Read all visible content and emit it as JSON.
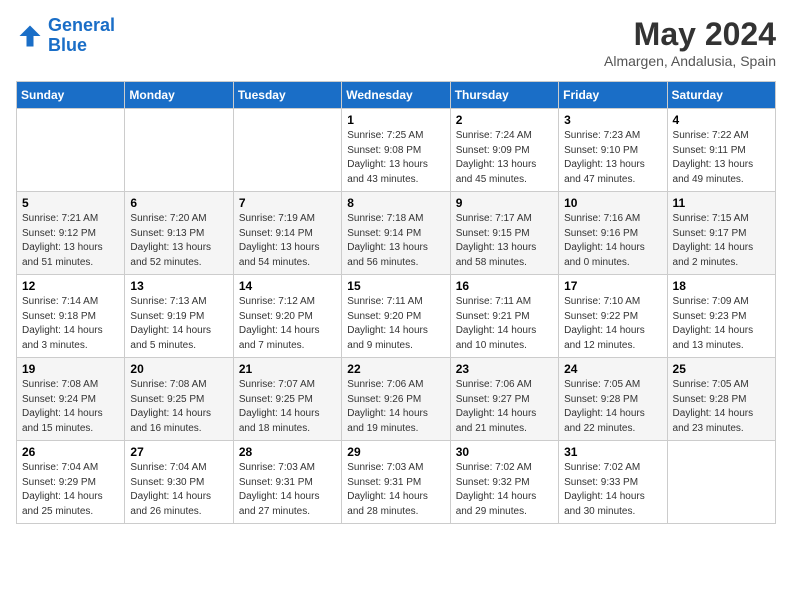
{
  "logo": {
    "line1": "General",
    "line2": "Blue"
  },
  "title": "May 2024",
  "location": "Almargen, Andalusia, Spain",
  "headers": [
    "Sunday",
    "Monday",
    "Tuesday",
    "Wednesday",
    "Thursday",
    "Friday",
    "Saturday"
  ],
  "weeks": [
    [
      {
        "day": "",
        "sunrise": "",
        "sunset": "",
        "daylight": ""
      },
      {
        "day": "",
        "sunrise": "",
        "sunset": "",
        "daylight": ""
      },
      {
        "day": "",
        "sunrise": "",
        "sunset": "",
        "daylight": ""
      },
      {
        "day": "1",
        "sunrise": "Sunrise: 7:25 AM",
        "sunset": "Sunset: 9:08 PM",
        "daylight": "Daylight: 13 hours and 43 minutes."
      },
      {
        "day": "2",
        "sunrise": "Sunrise: 7:24 AM",
        "sunset": "Sunset: 9:09 PM",
        "daylight": "Daylight: 13 hours and 45 minutes."
      },
      {
        "day": "3",
        "sunrise": "Sunrise: 7:23 AM",
        "sunset": "Sunset: 9:10 PM",
        "daylight": "Daylight: 13 hours and 47 minutes."
      },
      {
        "day": "4",
        "sunrise": "Sunrise: 7:22 AM",
        "sunset": "Sunset: 9:11 PM",
        "daylight": "Daylight: 13 hours and 49 minutes."
      }
    ],
    [
      {
        "day": "5",
        "sunrise": "Sunrise: 7:21 AM",
        "sunset": "Sunset: 9:12 PM",
        "daylight": "Daylight: 13 hours and 51 minutes."
      },
      {
        "day": "6",
        "sunrise": "Sunrise: 7:20 AM",
        "sunset": "Sunset: 9:13 PM",
        "daylight": "Daylight: 13 hours and 52 minutes."
      },
      {
        "day": "7",
        "sunrise": "Sunrise: 7:19 AM",
        "sunset": "Sunset: 9:14 PM",
        "daylight": "Daylight: 13 hours and 54 minutes."
      },
      {
        "day": "8",
        "sunrise": "Sunrise: 7:18 AM",
        "sunset": "Sunset: 9:14 PM",
        "daylight": "Daylight: 13 hours and 56 minutes."
      },
      {
        "day": "9",
        "sunrise": "Sunrise: 7:17 AM",
        "sunset": "Sunset: 9:15 PM",
        "daylight": "Daylight: 13 hours and 58 minutes."
      },
      {
        "day": "10",
        "sunrise": "Sunrise: 7:16 AM",
        "sunset": "Sunset: 9:16 PM",
        "daylight": "Daylight: 14 hours and 0 minutes."
      },
      {
        "day": "11",
        "sunrise": "Sunrise: 7:15 AM",
        "sunset": "Sunset: 9:17 PM",
        "daylight": "Daylight: 14 hours and 2 minutes."
      }
    ],
    [
      {
        "day": "12",
        "sunrise": "Sunrise: 7:14 AM",
        "sunset": "Sunset: 9:18 PM",
        "daylight": "Daylight: 14 hours and 3 minutes."
      },
      {
        "day": "13",
        "sunrise": "Sunrise: 7:13 AM",
        "sunset": "Sunset: 9:19 PM",
        "daylight": "Daylight: 14 hours and 5 minutes."
      },
      {
        "day": "14",
        "sunrise": "Sunrise: 7:12 AM",
        "sunset": "Sunset: 9:20 PM",
        "daylight": "Daylight: 14 hours and 7 minutes."
      },
      {
        "day": "15",
        "sunrise": "Sunrise: 7:11 AM",
        "sunset": "Sunset: 9:20 PM",
        "daylight": "Daylight: 14 hours and 9 minutes."
      },
      {
        "day": "16",
        "sunrise": "Sunrise: 7:11 AM",
        "sunset": "Sunset: 9:21 PM",
        "daylight": "Daylight: 14 hours and 10 minutes."
      },
      {
        "day": "17",
        "sunrise": "Sunrise: 7:10 AM",
        "sunset": "Sunset: 9:22 PM",
        "daylight": "Daylight: 14 hours and 12 minutes."
      },
      {
        "day": "18",
        "sunrise": "Sunrise: 7:09 AM",
        "sunset": "Sunset: 9:23 PM",
        "daylight": "Daylight: 14 hours and 13 minutes."
      }
    ],
    [
      {
        "day": "19",
        "sunrise": "Sunrise: 7:08 AM",
        "sunset": "Sunset: 9:24 PM",
        "daylight": "Daylight: 14 hours and 15 minutes."
      },
      {
        "day": "20",
        "sunrise": "Sunrise: 7:08 AM",
        "sunset": "Sunset: 9:25 PM",
        "daylight": "Daylight: 14 hours and 16 minutes."
      },
      {
        "day": "21",
        "sunrise": "Sunrise: 7:07 AM",
        "sunset": "Sunset: 9:25 PM",
        "daylight": "Daylight: 14 hours and 18 minutes."
      },
      {
        "day": "22",
        "sunrise": "Sunrise: 7:06 AM",
        "sunset": "Sunset: 9:26 PM",
        "daylight": "Daylight: 14 hours and 19 minutes."
      },
      {
        "day": "23",
        "sunrise": "Sunrise: 7:06 AM",
        "sunset": "Sunset: 9:27 PM",
        "daylight": "Daylight: 14 hours and 21 minutes."
      },
      {
        "day": "24",
        "sunrise": "Sunrise: 7:05 AM",
        "sunset": "Sunset: 9:28 PM",
        "daylight": "Daylight: 14 hours and 22 minutes."
      },
      {
        "day": "25",
        "sunrise": "Sunrise: 7:05 AM",
        "sunset": "Sunset: 9:28 PM",
        "daylight": "Daylight: 14 hours and 23 minutes."
      }
    ],
    [
      {
        "day": "26",
        "sunrise": "Sunrise: 7:04 AM",
        "sunset": "Sunset: 9:29 PM",
        "daylight": "Daylight: 14 hours and 25 minutes."
      },
      {
        "day": "27",
        "sunrise": "Sunrise: 7:04 AM",
        "sunset": "Sunset: 9:30 PM",
        "daylight": "Daylight: 14 hours and 26 minutes."
      },
      {
        "day": "28",
        "sunrise": "Sunrise: 7:03 AM",
        "sunset": "Sunset: 9:31 PM",
        "daylight": "Daylight: 14 hours and 27 minutes."
      },
      {
        "day": "29",
        "sunrise": "Sunrise: 7:03 AM",
        "sunset": "Sunset: 9:31 PM",
        "daylight": "Daylight: 14 hours and 28 minutes."
      },
      {
        "day": "30",
        "sunrise": "Sunrise: 7:02 AM",
        "sunset": "Sunset: 9:32 PM",
        "daylight": "Daylight: 14 hours and 29 minutes."
      },
      {
        "day": "31",
        "sunrise": "Sunrise: 7:02 AM",
        "sunset": "Sunset: 9:33 PM",
        "daylight": "Daylight: 14 hours and 30 minutes."
      },
      {
        "day": "",
        "sunrise": "",
        "sunset": "",
        "daylight": ""
      }
    ]
  ]
}
